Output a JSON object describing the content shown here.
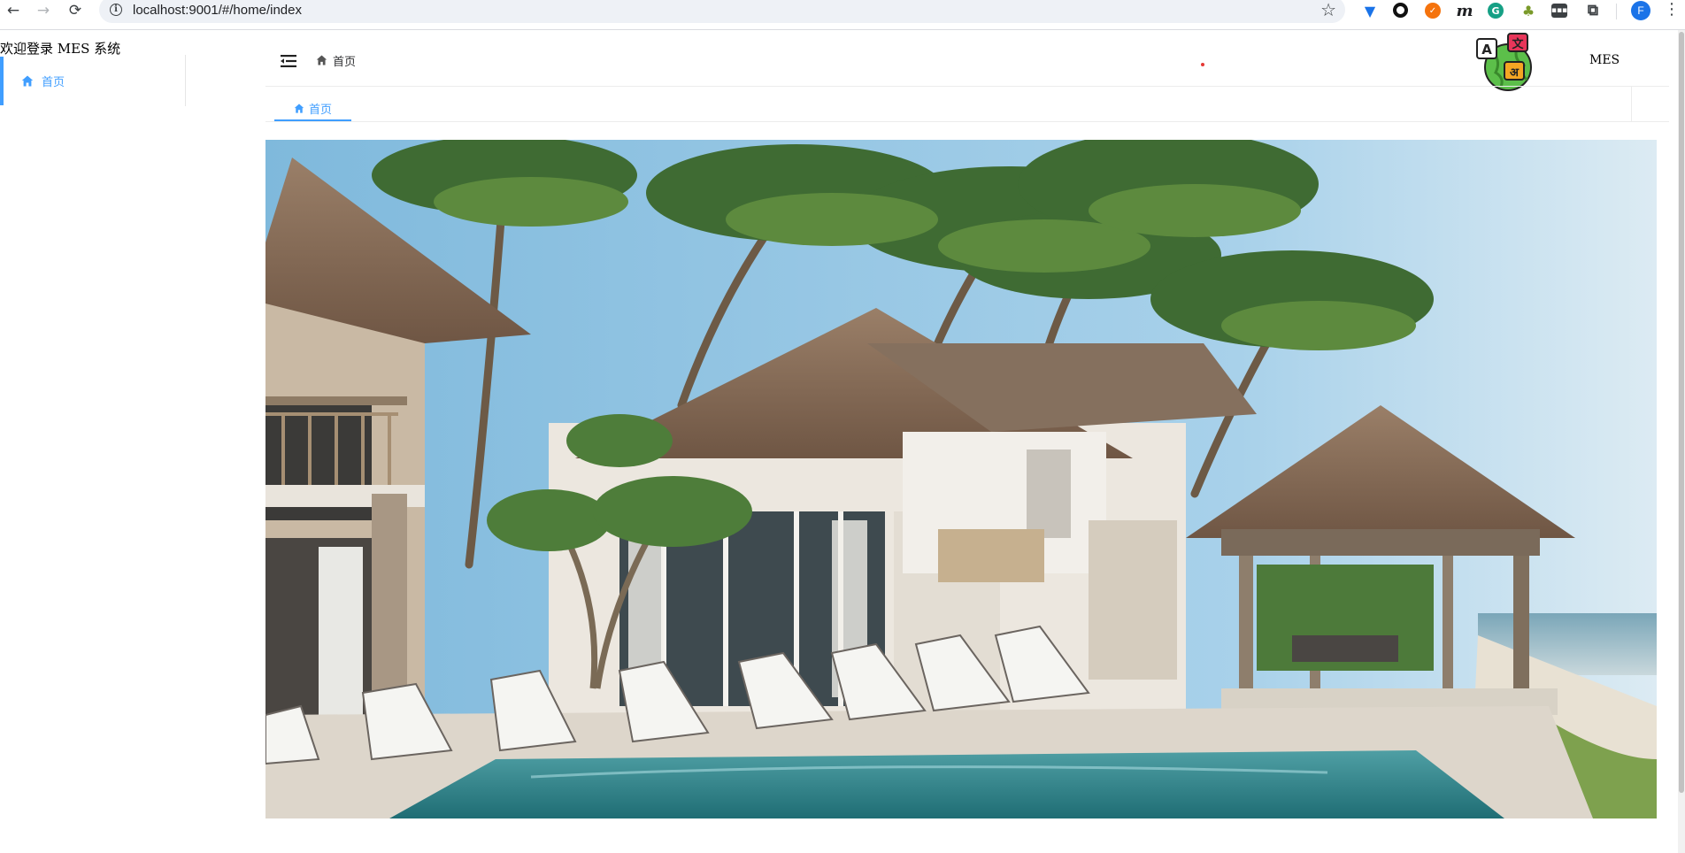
{
  "browser": {
    "url": "localhost:9001/#/home/index",
    "back_icon": "←",
    "forward_icon": "→",
    "reload_icon": "⟳",
    "info_icon": "i",
    "star_icon": "☆",
    "extensions": [
      {
        "name": "vue-devtools",
        "glyph": "▼"
      },
      {
        "name": "ring",
        "glyph": ""
      },
      {
        "name": "orange",
        "glyph": "✓"
      },
      {
        "name": "m",
        "glyph": "m"
      },
      {
        "name": "grammarly",
        "glyph": "G"
      },
      {
        "name": "tree",
        "glyph": "♣"
      },
      {
        "name": "keypad",
        "glyph": "▪▪▪"
      },
      {
        "name": "puzzle",
        "glyph": "⧉"
      }
    ],
    "profile_initial": "F",
    "menu_icon": "⋮"
  },
  "sidebar": {
    "title": "欢迎登录 MES 系统",
    "items": [
      {
        "label": "首页",
        "icon": "home-icon",
        "active": true
      }
    ]
  },
  "header": {
    "breadcrumb": "首页",
    "user_label": "MES"
  },
  "tabs": [
    {
      "label": "首页",
      "active": true
    }
  ],
  "colors": {
    "accent": "#409eff",
    "text": "#303133",
    "border": "#ececec"
  }
}
